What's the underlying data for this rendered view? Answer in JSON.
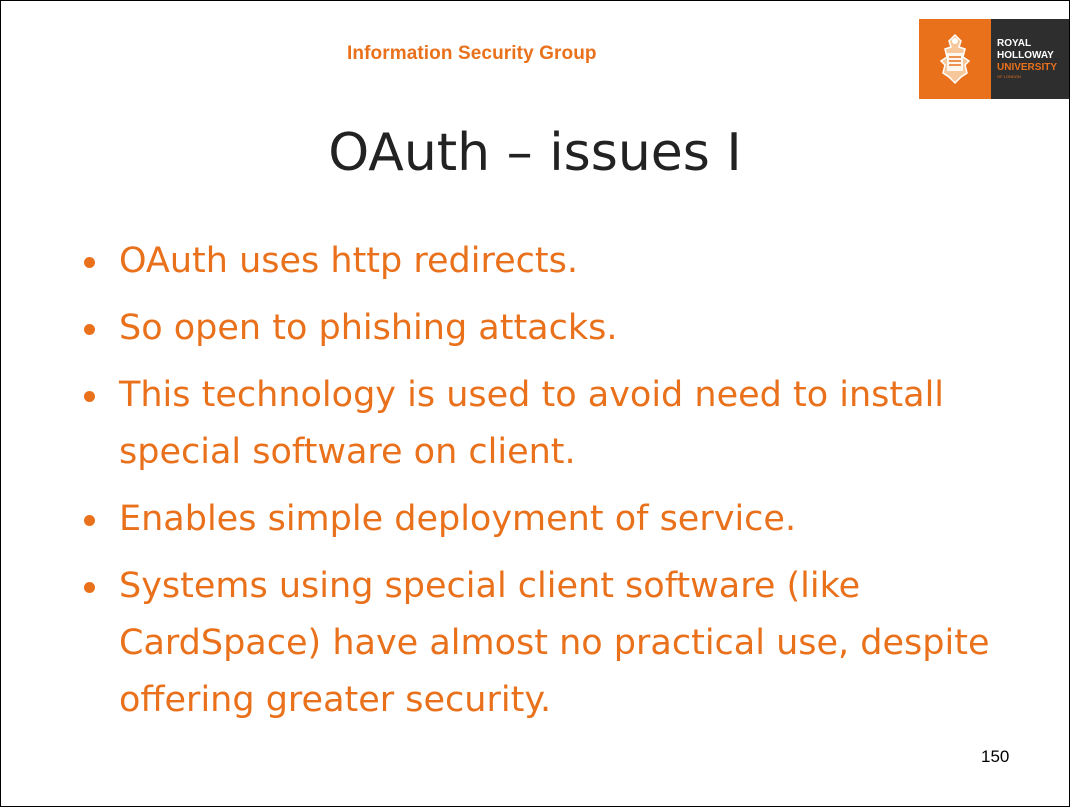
{
  "header": {
    "group_name": "Information Security Group"
  },
  "logo": {
    "line1": "ROYAL",
    "line2": "HOLLOWAY",
    "line3": "UNIVERSITY",
    "line4": "OF LONDON",
    "crest_icon": "crest-icon",
    "colors": {
      "orange": "#e9711c",
      "dark": "#2e2e2e"
    }
  },
  "slide": {
    "title": "OAuth – issues  I",
    "bullets": [
      "OAuth uses http redirects.",
      "So open to phishing attacks.",
      "This technology is used to avoid need to install special software on client.",
      "Enables simple deployment of service.",
      "Systems using special client software (like CardSpace) have almost no practical use, despite offering greater security."
    ],
    "page_number": "150"
  },
  "colors": {
    "accent": "#e9711c",
    "title": "#222222"
  }
}
